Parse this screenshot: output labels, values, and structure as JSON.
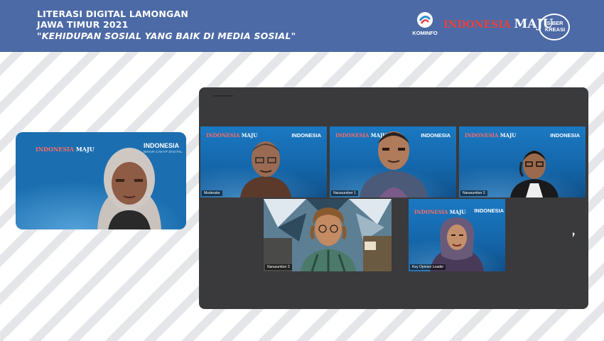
{
  "header": {
    "title_line1": "LITERASI DIGITAL LAMONGAN",
    "title_line2": "JAWA TIMUR 2021",
    "title_line3": "\"KEHIDUPAN SOSIAL YANG BAIK DI MEDIA SOSIAL\"",
    "logo_kominfo_label": "KOMINFO",
    "logo_indonesia": "INDONESIA",
    "logo_maju": "MAJU",
    "logo_siberkreasi_line1": "SIBER",
    "logo_siberkreasi_line2": "KREASI"
  },
  "self_view": {
    "brand_im": "INDONESIA",
    "brand_maju": "MAJU",
    "brand_indonesia": "INDONESIA",
    "brand_sub": "MAKIN CAKAP DIGITAL"
  },
  "participants": [
    {
      "name": "Moderator"
    },
    {
      "name": "Narasumber 1"
    },
    {
      "name": "Narasumber 2"
    },
    {
      "name": "Narasumber 3"
    },
    {
      "name": "Key Opinion Leader"
    }
  ],
  "tile_brand": {
    "im": "INDONESIA",
    "maju": "MAJU",
    "ind": "INDONESIA"
  },
  "colors": {
    "banner": "#4c6aa6",
    "panel": "#3a3a3c",
    "brand_blue": "#1b79c2",
    "accent_red": "#e8413a"
  }
}
